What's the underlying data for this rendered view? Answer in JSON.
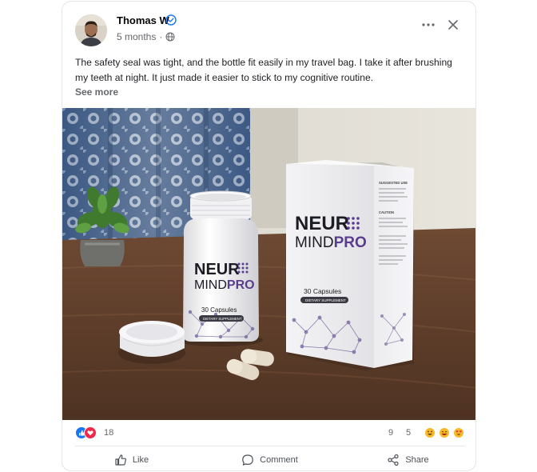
{
  "post": {
    "author": "Thomas W",
    "time": "5 months",
    "separator": "·",
    "text": "The safety seal was tight, and the bottle fit easily in my travel bag. I take it after brushing my teeth at night. It just made it easier to stick to my cognitive routine.",
    "see_more": "See more"
  },
  "photo": {
    "product_name_line1": "NEUR",
    "product_name_line2": "MIND",
    "product_name_pro": "PRO",
    "capsules_label": "30 Capsules",
    "supplement_label": "DIETARY SUPPLEMENT",
    "box_panel_heading1": "SUGGESTED USE",
    "box_panel_heading2": "CAUTION"
  },
  "stats": {
    "reaction_count": "18",
    "comment_count": "9",
    "share_count": "5",
    "reaction_icons": [
      "thumbs-up-icon",
      "heart-icon"
    ],
    "emoji_icons": [
      "grinning-face-icon",
      "laughing-face-icon",
      "heart-eyes-icon"
    ]
  },
  "actions": {
    "like": "Like",
    "comment": "Comment",
    "share": "Share"
  },
  "colors": {
    "brand_purple": "#5a3c8e",
    "verified_blue": "#1877f2",
    "heart_red": "#f02849"
  }
}
